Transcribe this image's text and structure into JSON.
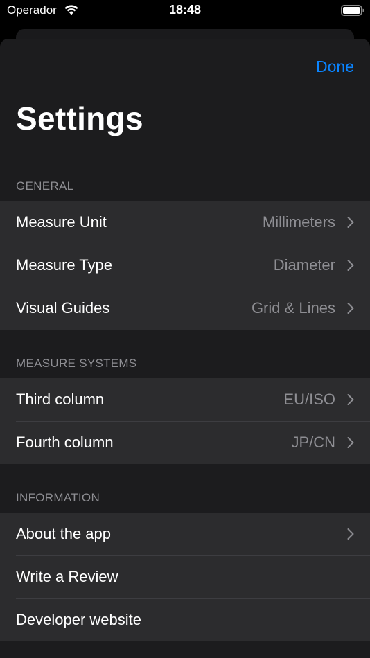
{
  "status_bar": {
    "carrier": "Operador",
    "time": "18:48"
  },
  "header": {
    "done_label": "Done",
    "title": "Settings"
  },
  "sections": {
    "general": {
      "title": "GENERAL",
      "rows": [
        {
          "label": "Measure Unit",
          "value": "Millimeters",
          "chevron": true
        },
        {
          "label": "Measure Type",
          "value": "Diameter",
          "chevron": true
        },
        {
          "label": "Visual Guides",
          "value": "Grid & Lines",
          "chevron": true
        }
      ]
    },
    "measure_systems": {
      "title": "MEASURE SYSTEMS",
      "rows": [
        {
          "label": "Third column",
          "value": "EU/ISO",
          "chevron": true
        },
        {
          "label": "Fourth column",
          "value": "JP/CN",
          "chevron": true
        }
      ]
    },
    "information": {
      "title": "INFORMATION",
      "rows": [
        {
          "label": "About the app",
          "value": "",
          "chevron": true
        },
        {
          "label": "Write a Review",
          "value": "",
          "chevron": false
        },
        {
          "label": "Developer website",
          "value": "",
          "chevron": false
        }
      ]
    }
  },
  "colors": {
    "accent": "#0a84ff",
    "background": "#000000",
    "sheet": "#1c1c1e",
    "cell": "#2c2c2e",
    "secondary_text": "#8e8e93"
  }
}
